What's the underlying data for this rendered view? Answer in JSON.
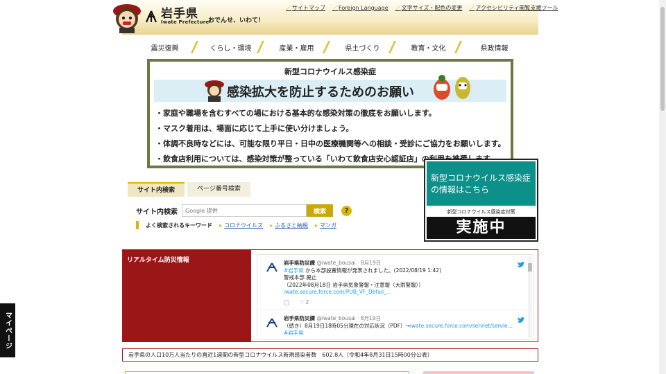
{
  "header": {
    "logo_title": "岩手県",
    "logo_sub": "Iwate Prefecture",
    "tagline": "おでんせ、いわて！",
    "util_links": [
      "サイトマップ",
      "Foreign Language",
      "文字サイズ・配色の変更",
      "アクセシビリティ閲覧支援ツール"
    ]
  },
  "nav": [
    "震災復興",
    "くらし・環境",
    "産業・雇用",
    "県土づくり",
    "教育・文化",
    "県政情報"
  ],
  "banner": {
    "top": "新型コロナウイルス感染症",
    "headline": "感染拡大を防止するためのお願い",
    "lines": [
      "・家庭や職場を含むすべての場における基本的な感染対策の徹底をお願いします。",
      "・マスク着用は、場面に応じて上手に使い分けましょう。",
      "・体調不良時などには、可能な限り平日・日中の医療機関等への相談・受診にご協力をお願いします。",
      "・飲食店利用については、感染対策が整っている「いわて飲食店安心認証店」の利用を推奨します。"
    ]
  },
  "covid_ad": {
    "main": "新型コロナウイルス感染症の情報はこちら",
    "sub": "新型コロナウイルス感染症対策",
    "bottom": "実施中"
  },
  "search": {
    "tabs": [
      "サイト内検索",
      "ページ番号検索"
    ],
    "label": "サイト内検索",
    "placeholder": "Google 提供",
    "button": "検索",
    "help": "?",
    "keywords_label": "よく検索されるキーワード",
    "keywords": [
      "コロナウイルス",
      "ふるさと納税",
      "マンガ"
    ]
  },
  "disaster": {
    "title": "リアルタイム防災情報",
    "tweets": [
      {
        "name": "岩手県防災課",
        "handle": "@iwate_bousai · 8月19日",
        "tag": "#岩手県",
        "text1": " から本部設置情報が発表されました。(2022/08/19 1:42)",
        "text2": "警戒本部 廃止",
        "text3": "（2022年08月18日 岩手県気象警報・注意報（大雨警報））",
        "link": "iwate.secure.force.com/PUB_VF_Detail_...",
        "likes": "2"
      },
      {
        "name": "岩手県防災課",
        "handle": "@iwate_bousai · 8月19日",
        "text1": "（続き）8月19日18時05分現在の対応状況（PDF）→",
        "link": "iwate.secure.force.com/servlet/servle...",
        "tag": "#岩手県"
      }
    ]
  },
  "notice": "岩手県の人口10万人当たりの直近1週間の新型コロナウイルス新規感染者数　602.8人（令和4年8月31日15時00分公表）",
  "mypage": "マイページ"
}
